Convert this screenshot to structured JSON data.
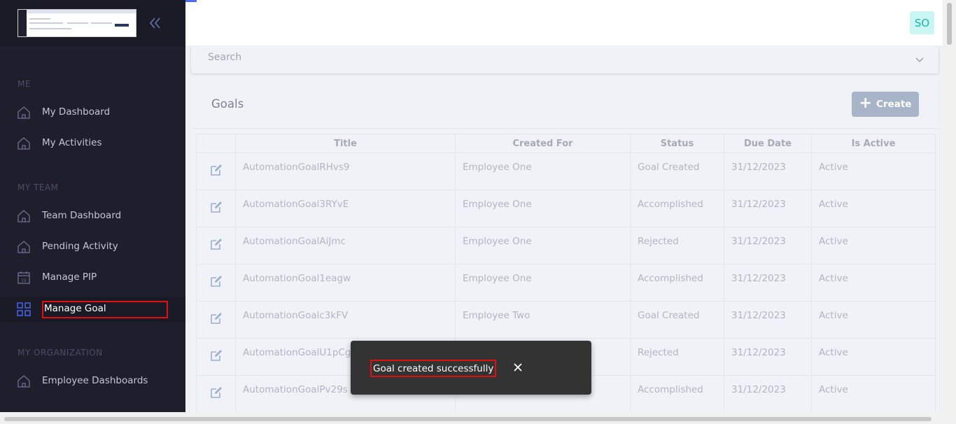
{
  "sidebar": {
    "sections": [
      {
        "label": "ME"
      },
      {
        "label": "MY TEAM"
      },
      {
        "label": "MY ORGANIZATION"
      }
    ],
    "items": [
      {
        "label": "My Dashboard",
        "icon": "home-icon"
      },
      {
        "label": "My Activities",
        "icon": "home-icon"
      },
      {
        "label": "Team Dashboard",
        "icon": "home-icon"
      },
      {
        "label": "Pending Activity",
        "icon": "home-icon"
      },
      {
        "label": "Manage PIP",
        "icon": "calendar-icon"
      },
      {
        "label": "Manage Goal",
        "icon": "grid-icon",
        "active": true
      },
      {
        "label": "Employee Dashboards",
        "icon": "home-icon"
      }
    ]
  },
  "header": {
    "avatar_initials": "SO"
  },
  "search": {
    "label": "Search"
  },
  "goals": {
    "title": "Goals",
    "create_label": "Create",
    "columns": [
      "",
      "Title",
      "Created For",
      "Status",
      "Due Date",
      "Is Active"
    ],
    "rows": [
      {
        "title": "AutomationGoalRHvs9",
        "created_for": "Employee One",
        "status": "Goal Created",
        "due_date": "31/12/2023",
        "is_active": "Active"
      },
      {
        "title": "AutomationGoal3RYvE",
        "created_for": "Employee One",
        "status": "Accomplished",
        "due_date": "31/12/2023",
        "is_active": "Active"
      },
      {
        "title": "AutomationGoalAiJmc",
        "created_for": "Employee One",
        "status": "Rejected",
        "due_date": "31/12/2023",
        "is_active": "Active"
      },
      {
        "title": "AutomationGoal1eagw",
        "created_for": "Employee One",
        "status": "Accomplished",
        "due_date": "31/12/2023",
        "is_active": "Active"
      },
      {
        "title": "AutomationGoalc3kFV",
        "created_for": "Employee Two",
        "status": "Goal Created",
        "due_date": "31/12/2023",
        "is_active": "Active"
      },
      {
        "title": "AutomationGoalU1pCg",
        "created_for": "",
        "status": "Rejected",
        "due_date": "31/12/2023",
        "is_active": "Active"
      },
      {
        "title": "AutomationGoalPv29s",
        "created_for": "",
        "status": "Accomplished",
        "due_date": "31/12/2023",
        "is_active": "Active"
      }
    ]
  },
  "toast": {
    "message": "Goal created successfully"
  },
  "colors": {
    "sidebar_bg": "#1e1e2d",
    "accent": "#4a6cf7",
    "create_button": "#a8b4c8",
    "avatar_bg": "#c9f5f2",
    "highlight": "#e01010"
  }
}
